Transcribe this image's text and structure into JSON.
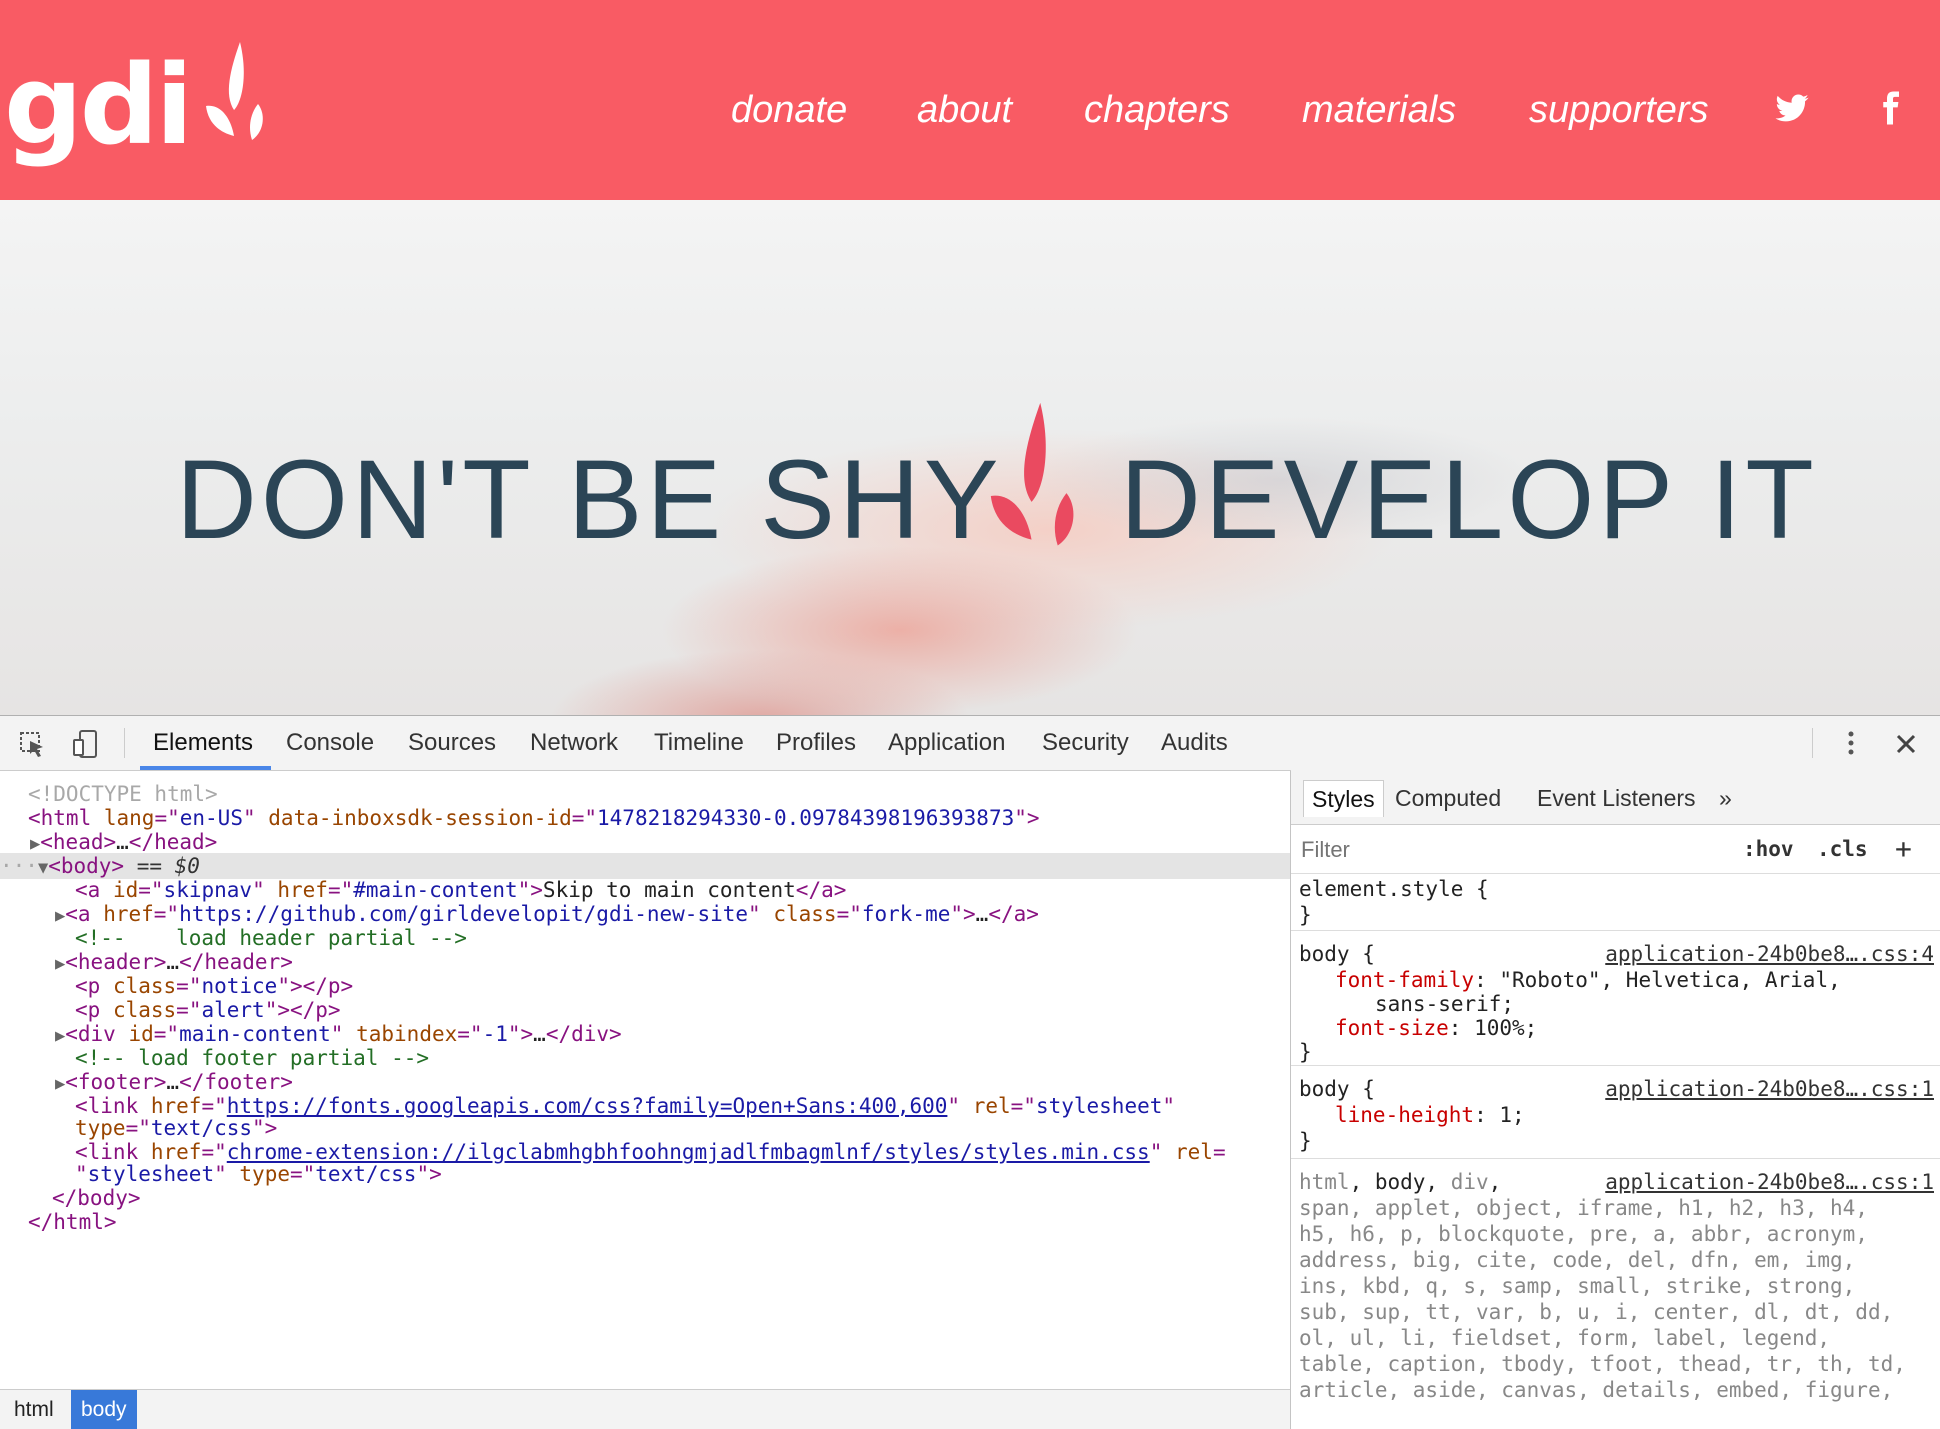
{
  "site": {
    "logo_text": "gdi",
    "nav": [
      "donate",
      "about",
      "chapters",
      "materials",
      "supporters"
    ],
    "social": [
      "twitter-icon",
      "facebook-icon"
    ],
    "brand_color": "#f95b64",
    "hero_left": "DON'T BE SHY",
    "hero_right": "DEVELOP IT",
    "hero_text_color": "#2b4556"
  },
  "devtools": {
    "tabs": [
      "Elements",
      "Console",
      "Sources",
      "Network",
      "Timeline",
      "Profiles",
      "Application",
      "Security",
      "Audits"
    ],
    "active_tab": "Elements",
    "dom": {
      "doctype": "<!DOCTYPE html>",
      "html_lang": "en-US",
      "html_session_attr": "data-inboxsdk-session-id",
      "html_session_id": "1478218294330-0.09784398196393873",
      "head": "head",
      "body": "body",
      "selected_marker": "== $0",
      "skipnav_id": "skipnav",
      "skipnav_href": "#main-content",
      "skipnav_text": "Skip to main content",
      "fork_href": "https://github.com/girldevelopit/gdi-new-site",
      "fork_class": "fork-me",
      "comment_header": "<!--    load header partial -->",
      "header": "header",
      "p_notice": "notice",
      "p_alert": "alert",
      "main_id": "main-content",
      "main_tabindex": "-1",
      "comment_footer": "<!-- load footer partial -->",
      "footer": "footer",
      "link1_href": "https://fonts.googleapis.com/css?family=Open+Sans:400,600",
      "link2_href": "chrome-extension://ilgclabmhgbhfoohngmjadlfmbagmlnf/styles/styles.min.css",
      "rel_value": "stylesheet",
      "type_value": "text/css"
    },
    "breadcrumbs": [
      "html",
      "body"
    ],
    "active_breadcrumb": "body",
    "styles": {
      "tabs": [
        "Styles",
        "Computed",
        "Event Listeners"
      ],
      "more": "»",
      "filter_placeholder": "Filter",
      "hov": ":hov",
      "cls": ".cls",
      "add": "+",
      "element_style": "element.style {",
      "rule1": {
        "selector": "body {",
        "source": "application-24b0be8….css:4",
        "prop1": "font-family",
        "val1": "\"Roboto\", Helvetica, Arial,",
        "val1b": "sans-serif;",
        "prop2": "font-size",
        "val2": "100%;"
      },
      "rule2": {
        "selector": "body {",
        "source": "application-24b0be8….css:1",
        "prop1": "line-height",
        "val1": "1;"
      },
      "rule3": {
        "source": "application-24b0be8….css:1",
        "lines": [
          "span, applet, object, iframe, h1, h2, h3, h4,",
          "h5, h6, p, blockquote, pre, a, abbr, acronym,",
          "address, big, cite, code, del, dfn, em, img,",
          "ins, kbd, q, s, samp, small, strike, strong,",
          "sub, sup, tt, var, b, u, i, center, dl, dt, dd,",
          "ol, ul, li, fieldset, form, label, legend,",
          "table, caption, tbody, tfoot, thead, tr, th, td,",
          "article, aside, canvas, details, embed, figure,"
        ]
      }
    }
  }
}
